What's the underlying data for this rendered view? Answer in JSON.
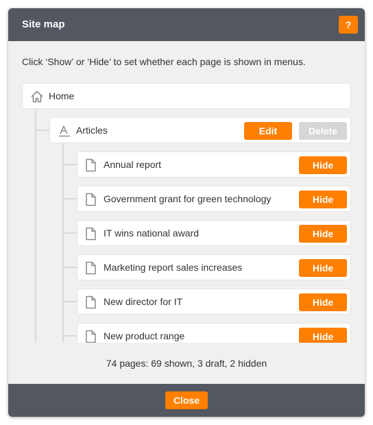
{
  "dialog": {
    "title": "Site map",
    "help_label": "?",
    "instruction": "Click ‘Show’ or ‘Hide’ to set whether each page is shown in menus.",
    "close_label": "Close",
    "summary": "74 pages: 69 shown, 3 draft, 2 hidden"
  },
  "tree": {
    "root": {
      "label": "Home",
      "icon": "home-icon"
    },
    "section": {
      "label": "Articles",
      "icon": "articles-icon",
      "edit_label": "Edit",
      "delete_label": "Delete"
    },
    "pages": [
      {
        "label": "Annual report",
        "action_label": "Hide",
        "icon": "page-icon"
      },
      {
        "label": "Government grant for green technology",
        "action_label": "Hide",
        "icon": "page-icon"
      },
      {
        "label": "IT wins national award",
        "action_label": "Hide",
        "icon": "page-icon"
      },
      {
        "label": "Marketing report sales increases",
        "action_label": "Hide",
        "icon": "page-icon"
      },
      {
        "label": "New director for IT",
        "action_label": "Hide",
        "icon": "page-icon"
      },
      {
        "label": "New product range",
        "action_label": "Hide",
        "icon": "page-icon"
      }
    ]
  },
  "colors": {
    "accent": "#ff7f00",
    "header_bg": "#525760",
    "body_bg": "#f0f0f0",
    "disabled": "#d6d6d6"
  }
}
